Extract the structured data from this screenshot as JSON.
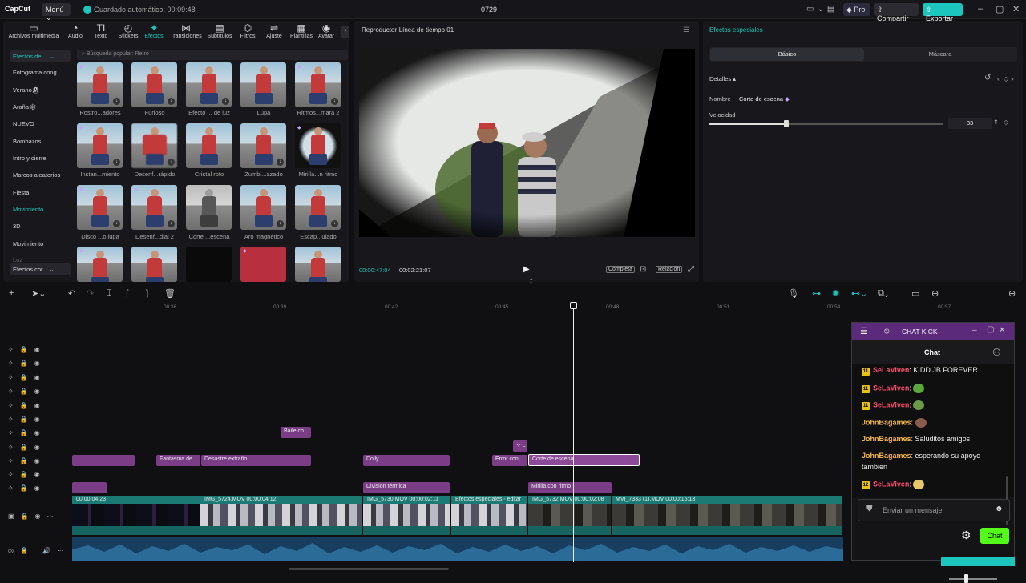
{
  "titlebar": {
    "app": "CapCut",
    "menu": "Menú",
    "autosave": "Guardado automático: 00:09:48",
    "project": "0729",
    "pro": "Pro",
    "share": "Compartir",
    "export": "Exportar"
  },
  "tabs": [
    {
      "label": "Archivos multimedia",
      "icon": "▭"
    },
    {
      "label": "Audio",
      "icon": "◔"
    },
    {
      "label": "Texto",
      "icon": "TI"
    },
    {
      "label": "Stickers",
      "icon": "◴"
    },
    {
      "label": "Efectos",
      "icon": "✦"
    },
    {
      "label": "Transiciones",
      "icon": "⋈"
    },
    {
      "label": "Subtítulos",
      "icon": "▤"
    },
    {
      "label": "Filtros",
      "icon": "⌬"
    },
    {
      "label": "Ajuste",
      "icon": "⇌"
    },
    {
      "label": "Plantillas",
      "icon": "▦"
    },
    {
      "label": "Avatar",
      "icon": "◉"
    }
  ],
  "categories": {
    "dropdown": "Efectos de ...",
    "items": [
      "Fotograma cong...",
      "Verano🏖",
      "Araña🕸",
      "NUEVO",
      "Bombazos",
      "Intro y cierre",
      "Marcos aleatorios",
      "Fiesta",
      "Movimiento",
      "3D",
      "Movimiento",
      "Luz"
    ],
    "active_index": 8,
    "bottom_dropdown": "Efectos cor..."
  },
  "search": {
    "placeholder": "Búsqueda popular: Retro"
  },
  "effects": [
    "Rostro...adores",
    "Furioso",
    "Efecto ... de luz",
    "Lupa",
    "Ritmos...mara 2",
    "Instan...miento",
    "Desenf...rápido",
    "Cristal roto",
    "Zumbi...azado",
    "Mirilla...n ritmo",
    "Disco ...o lupa",
    "Desenf...dial 2",
    "Corte ...escena",
    "Aro magnético",
    "Escap...ulado"
  ],
  "player": {
    "title": "Reproductor-Línea de tiempo 01",
    "current_time": "00:00:47:04",
    "total_time": "00:02:21:07",
    "full": "Completa",
    "ratio": "Relación"
  },
  "effect_panel": {
    "title": "Efectos especiales",
    "tab_basic": "Básico",
    "tab_mask": "Máscara",
    "details": "Detalles",
    "name_label": "Nombre",
    "name_value": "Corte de escena",
    "speed_label": "Velocidad",
    "speed_value": "33",
    "speed_fraction": 0.33
  },
  "ruler": [
    "00:36",
    "00:39",
    "00:42",
    "00:45",
    "00:48",
    "00:51",
    "00:54",
    "00:57"
  ],
  "effect_clips": {
    "baile": "Baile co",
    "fantasma": "Fantasma de",
    "desastre": "Desastre extraño",
    "dolly": "Dolly",
    "error": "Error con",
    "corte": "Corte de escena",
    "division": "División térmica",
    "mirilla": "Mirilla con ritmo"
  },
  "video_clips": [
    {
      "label": "00:00:04:23"
    },
    {
      "label": "IMG_5724.MOV  00:00:04:12"
    },
    {
      "label": "IMG_5730.MOV  00:00:02:11"
    },
    {
      "label": "Efectos especiales - editar"
    },
    {
      "label": "IMG_5732.MOV  00:00:02:08"
    },
    {
      "label": "MVI_7333 (1).MOV  00:00:15:13"
    }
  ],
  "chat": {
    "window_title": "CHAT KICK",
    "header": "Chat",
    "messages": [
      {
        "badge": "11",
        "user": "SeLaViven",
        "text": ": KIDD JB FOREVER"
      },
      {
        "badge": "11",
        "user": "SeLaViven",
        "text": ":"
      },
      {
        "badge": "11",
        "user": "SeLaViven",
        "text": ":"
      },
      {
        "badge": "",
        "user": "JohnBagames",
        "text": ":"
      },
      {
        "badge": "",
        "user": "JohnBagames",
        "text": ": Saluditos amigos"
      },
      {
        "badge": "",
        "user": "JohnBagames",
        "text": ": esperando su apoyo"
      },
      {
        "badge": "",
        "user": "",
        "text": "tambien"
      },
      {
        "badge": "12",
        "user": "SeLaViven",
        "text": ":"
      }
    ],
    "input_placeholder": "Enviar un mensaje",
    "send": "Chat"
  },
  "colors": {
    "accent": "#1cc5bd",
    "effect_clip": "#7a3d86",
    "kick_green": "#53fc18"
  }
}
